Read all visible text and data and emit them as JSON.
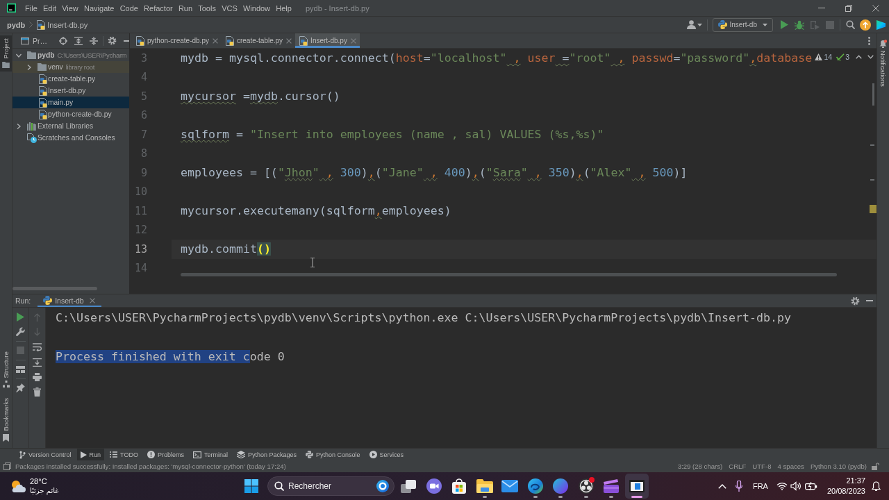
{
  "window": {
    "title": "pydb - Insert-db.py"
  },
  "menu": [
    "File",
    "Edit",
    "View",
    "Navigate",
    "Code",
    "Refactor",
    "Run",
    "Tools",
    "VCS",
    "Window",
    "Help"
  ],
  "breadcrumb": [
    "pydb",
    "Insert-db.py"
  ],
  "run_config": {
    "label": "Insert-db"
  },
  "toolbar": [
    {
      "kind": "run",
      "disabled": false
    },
    {
      "kind": "debug",
      "disabled": false
    },
    {
      "kind": "coverage",
      "disabled": true
    },
    {
      "kind": "stop",
      "disabled": true
    }
  ],
  "left_stripe": {
    "top": [
      {
        "label": "Project",
        "kind": "project",
        "selected": true
      }
    ],
    "bottom": [
      {
        "label": "Structure",
        "kind": "structure",
        "selected": false
      },
      {
        "label": "Bookmarks",
        "kind": "bookmarks",
        "selected": false
      }
    ]
  },
  "right_stripe": [
    {
      "label": "Notifications",
      "kind": "notifications"
    }
  ],
  "project": {
    "title": "Pr…",
    "tree": [
      {
        "label": "pydb",
        "hint": "C:\\Users\\USER\\Pycharm",
        "kind": "project",
        "expanded": true,
        "selected": false,
        "children": [
          {
            "label": "venv",
            "hint": "library root",
            "kind": "library-folder",
            "expanded": false,
            "selected": false
          },
          {
            "label": "create-table.py",
            "kind": "python",
            "selected": false
          },
          {
            "label": "Insert-db.py",
            "kind": "python",
            "selected": false
          },
          {
            "label": "main.py",
            "kind": "python",
            "selected": true
          },
          {
            "label": "python-create-db.py",
            "kind": "python",
            "selected": false
          }
        ]
      },
      {
        "label": "External Libraries",
        "kind": "libraries",
        "expanded": false,
        "selected": false
      },
      {
        "label": "Scratches and Consoles",
        "kind": "scratches",
        "selected": false
      }
    ]
  },
  "editor": {
    "tabs": [
      {
        "label": "python-create-db.py",
        "selected": false
      },
      {
        "label": "create-table.py",
        "selected": false
      },
      {
        "label": "Insert-db.py",
        "selected": true
      }
    ],
    "inspections": {
      "warnings": "14",
      "weak_warnings": "3"
    },
    "lines": [
      {
        "number": "3",
        "current": false,
        "tokens": [
          {
            "text": "mydb = mysql.connector.connect(",
            "kind": "plain",
            "squiggle": false
          },
          {
            "text": "host",
            "kind": "param",
            "squiggle": false
          },
          {
            "text": "=",
            "kind": "plain",
            "squiggle": false
          },
          {
            "text": "\"localhost\"",
            "kind": "string",
            "squiggle": false
          },
          {
            "text": " ,",
            "kind": "punct",
            "squiggle": true
          },
          {
            "text": " user",
            "kind": "param",
            "squiggle": false
          },
          {
            "text": " =",
            "kind": "plain",
            "squiggle": true
          },
          {
            "text": "\"root\"",
            "kind": "string",
            "squiggle": false
          },
          {
            "text": " ,",
            "kind": "punct",
            "squiggle": true
          },
          {
            "text": " passwd",
            "kind": "param",
            "squiggle": false
          },
          {
            "text": "=",
            "kind": "plain",
            "squiggle": false
          },
          {
            "text": "\"password\"",
            "kind": "string",
            "squiggle": false
          },
          {
            "text": ",",
            "kind": "punct",
            "squiggle": true
          },
          {
            "text": "database",
            "kind": "param",
            "squiggle": false
          }
        ]
      },
      {
        "number": "4",
        "current": false
      },
      {
        "number": "5",
        "current": false,
        "tokens": [
          {
            "text": "mycursor",
            "kind": "plain",
            "squiggle": true
          },
          {
            "text": " =",
            "kind": "plain",
            "squiggle": false
          },
          {
            "text": "mydb",
            "kind": "plain",
            "squiggle": true
          },
          {
            "text": ".cursor()",
            "kind": "plain",
            "squiggle": false
          }
        ]
      },
      {
        "number": "6",
        "current": false
      },
      {
        "number": "7",
        "current": false,
        "tokens": [
          {
            "text": "sqlform",
            "kind": "plain",
            "squiggle": true
          },
          {
            "text": " = ",
            "kind": "plain",
            "squiggle": false
          },
          {
            "text": "\"Insert into employees (name , sal) VALUES (%s,%s)\"",
            "kind": "string",
            "squiggle": false
          }
        ]
      },
      {
        "number": "8",
        "current": false
      },
      {
        "number": "9",
        "current": false,
        "tokens": [
          {
            "text": "employees = [(",
            "kind": "plain",
            "squiggle": false
          },
          {
            "text": "\"",
            "kind": "string",
            "squiggle": false
          },
          {
            "text": "Jhon",
            "kind": "string",
            "squiggle": true
          },
          {
            "text": "\"",
            "kind": "string",
            "squiggle": false
          },
          {
            "text": " ,",
            "kind": "punct",
            "squiggle": true
          },
          {
            "text": " 300",
            "kind": "number",
            "squiggle": false
          },
          {
            "text": ")",
            "kind": "plain",
            "squiggle": false
          },
          {
            "text": ",",
            "kind": "punct",
            "squiggle": true
          },
          {
            "text": "(",
            "kind": "plain",
            "squiggle": false
          },
          {
            "text": "\"Jane\"",
            "kind": "string",
            "squiggle": false
          },
          {
            "text": " ,",
            "kind": "punct",
            "squiggle": true
          },
          {
            "text": " 400",
            "kind": "number",
            "squiggle": false
          },
          {
            "text": ")",
            "kind": "plain",
            "squiggle": false
          },
          {
            "text": ",",
            "kind": "punct",
            "squiggle": true
          },
          {
            "text": "(",
            "kind": "plain",
            "squiggle": false
          },
          {
            "text": "\"",
            "kind": "string",
            "squiggle": false
          },
          {
            "text": "Sara",
            "kind": "string",
            "squiggle": true
          },
          {
            "text": "\"",
            "kind": "string",
            "squiggle": false
          },
          {
            "text": " ,",
            "kind": "punct",
            "squiggle": true
          },
          {
            "text": " 350",
            "kind": "number",
            "squiggle": false
          },
          {
            "text": ")",
            "kind": "plain",
            "squiggle": false
          },
          {
            "text": ",",
            "kind": "punct",
            "squiggle": true
          },
          {
            "text": "(",
            "kind": "plain",
            "squiggle": false
          },
          {
            "text": "\"Alex\"",
            "kind": "string",
            "squiggle": false
          },
          {
            "text": " ,",
            "kind": "punct",
            "squiggle": true
          },
          {
            "text": " 500",
            "kind": "number",
            "squiggle": false
          },
          {
            "text": ")]",
            "kind": "plain",
            "squiggle": false
          }
        ]
      },
      {
        "number": "10",
        "current": false
      },
      {
        "number": "11",
        "current": false,
        "tokens": [
          {
            "text": "mycursor.executemany(sqlform",
            "kind": "plain",
            "squiggle": false
          },
          {
            "text": ",",
            "kind": "punct",
            "squiggle": true
          },
          {
            "text": "employees)",
            "kind": "plain",
            "squiggle": false
          }
        ]
      },
      {
        "number": "12",
        "current": false
      },
      {
        "number": "13",
        "current": true,
        "tokens": [
          {
            "text": "mydb.commit",
            "kind": "plain",
            "squiggle": false
          },
          {
            "text": "()",
            "kind": "brace",
            "squiggle": false
          }
        ]
      },
      {
        "number": "14",
        "current": false
      }
    ]
  },
  "run": {
    "title": "Run:",
    "tabs": [
      {
        "label": "Insert-db",
        "selected": true
      }
    ],
    "toolbar_main": [
      [
        {
          "kind": "rerun",
          "disabled": false
        },
        {
          "kind": "wrench",
          "disabled": false
        }
      ],
      [
        {
          "kind": "stop",
          "disabled": true
        }
      ],
      [
        {
          "kind": "layout",
          "disabled": false
        }
      ],
      [
        {
          "kind": "pin",
          "disabled": false
        }
      ]
    ],
    "toolbar_console": [
      {
        "kind": "up",
        "disabled": true
      },
      {
        "kind": "down",
        "disabled": true
      },
      {
        "kind": "wrap",
        "disabled": false
      },
      {
        "kind": "scroll-end",
        "disabled": false
      },
      {
        "kind": "print",
        "disabled": false
      },
      {
        "kind": "clear",
        "disabled": false
      }
    ],
    "console": [
      {
        "segments": [
          {
            "text": "C:\\Users\\USER\\PycharmProjects\\pydb\\venv\\Scripts\\python.exe C:\\Users\\USER\\PycharmProjects\\pydb\\Insert-db.py",
            "selected": false
          }
        ]
      },
      {
        "segments": [
          {
            "text": "Process finished with exit c",
            "selected": true
          },
          {
            "text": "ode 0",
            "selected": false
          }
        ]
      }
    ]
  },
  "tool_windows": [
    {
      "label": "Version Control",
      "kind": "vcs",
      "selected": false
    },
    {
      "label": "Run",
      "kind": "run",
      "selected": true
    },
    {
      "label": "TODO",
      "kind": "todo",
      "selected": false
    },
    {
      "label": "Problems",
      "kind": "problems",
      "selected": false
    },
    {
      "label": "Terminal",
      "kind": "terminal",
      "selected": false
    },
    {
      "label": "Python Packages",
      "kind": "packages",
      "selected": false
    },
    {
      "label": "Python Console",
      "kind": "console",
      "selected": false
    },
    {
      "label": "Services",
      "kind": "services",
      "selected": false
    }
  ],
  "status": {
    "message": "Packages installed successfully: Installed packages: 'mysql-connector-python' (today 17:24)",
    "items": [
      "3:29 (28 chars)",
      "CRLF",
      "UTF-8",
      "4 spaces",
      "Python 3.10 (pydb)"
    ]
  },
  "taskbar": {
    "weather": {
      "temperature": "28°C",
      "condition": "غائم جزئيًا"
    },
    "search": {
      "placeholder": "Rechercher"
    },
    "apps": [
      {
        "kind": "task-view",
        "selected": false,
        "running": false,
        "alert": false
      },
      {
        "kind": "chat",
        "selected": false,
        "running": false,
        "alert": false
      },
      {
        "kind": "store",
        "selected": false,
        "running": false,
        "alert": false
      },
      {
        "kind": "files",
        "selected": false,
        "running": true,
        "alert": false
      },
      {
        "kind": "mail",
        "selected": false,
        "running": false,
        "alert": false
      },
      {
        "kind": "browser",
        "selected": false,
        "running": true,
        "alert": false
      },
      {
        "kind": "design",
        "selected": false,
        "running": true,
        "alert": false
      },
      {
        "kind": "recorder",
        "selected": false,
        "running": true,
        "alert": true
      },
      {
        "kind": "video",
        "selected": false,
        "running": true,
        "alert": false
      },
      {
        "kind": "window",
        "selected": true,
        "running": true,
        "alert": false
      }
    ],
    "language": "FRA",
    "time": "21:37",
    "date": "20/08/2023"
  }
}
